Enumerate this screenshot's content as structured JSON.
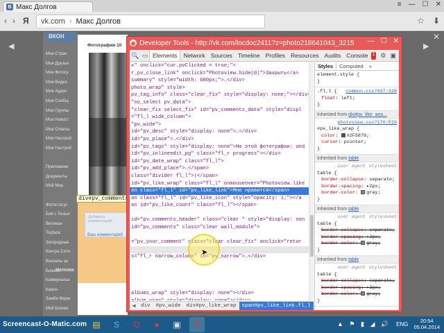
{
  "browser": {
    "tab_title": "Макс Долгов",
    "address_host": "vk.com",
    "address_title": "Макс Долгов",
    "logo": "Я",
    "nav_back": "‹",
    "nav_forward": "›",
    "minimize": "—",
    "maximize": "☐",
    "close": "✕",
    "menu": "≡",
    "download": "⬇",
    "star": "☆"
  },
  "vk_page": {
    "logo": "ВКОН",
    "menu_items": [
      "Мои Стран",
      "Мои Друзья",
      "Мои Фотогр",
      "Мои Видео",
      "Мои Аудио",
      "Мои Сообщ",
      "Мои Группы",
      "Мои Новост",
      "Мои Ответы",
      "Мои Настрой",
      "Мои Настрой",
      "",
      "Приложени",
      "Документы",
      "Мой Мир",
      "",
      "Фотостатус",
      "Бой с Тенью",
      "Вегеман",
      "Topface",
      "Загородные",
      "Контра Сити",
      "Вокзалы за",
      "Бизнес",
      "Коммунальн",
      "Канон",
      "Зомби Ферм",
      "Мой Бизнес"
    ],
    "photo_title": "Фотография 10",
    "comment_placeholder": "Добавить комментарий...",
    "comment_link": "Ваш комментарий",
    "bottom_label": "Напоми",
    "inspect_tooltip": "div#pv_comments_",
    "prev_arrow": "◀",
    "next_arrow": "▶",
    "close_x": "✕"
  },
  "devtools": {
    "title": "Developer Tools - http://vk.com/locdoc2411?z=photo218641043_3215130...",
    "icon_letter": "◉",
    "win_minimize": "—",
    "win_maximize": "☐",
    "win_close": "✕",
    "tool_search": "🔍",
    "tool_device": "▭",
    "tabs": [
      "Elements",
      "Network",
      "Sources",
      "Timeline",
      "Profiles",
      "Resources",
      "Audits",
      "Console"
    ],
    "active_tab": "Elements",
    "error_count": "1",
    "settings_icon": "⚙",
    "dock_icon": "▣",
    "dom_lines": [
      "x\" onclick=\"cur.pvClicked = true;\">",
      "r_pv_close_link\" onclick=\"Photoview.hide(0)\">Закрыть</a>",
      "summary\" style=\"width: 600px;\">…</div>",
      "photo_wrap\" style>",
      "pv_tag_info\" class=\"clear_fix\" style=\"display: none;\"></div>",
      "\"no_select pv_data\">",
      "\"clear_fix select_fix\" id=\"pv_comments_data\" style=\"displ",
      "=\"fl_l wide_column\">",
      "\"pv_wide\">",
      "id=\"pv_desc\" style=\"display: none\">…</div>",
      "id=\"pv_place\">…</div>",
      "id=\"pv_tags\" style=\"display: none\">На этой фотографии: und",
      "id=\"pv_inlineedit_pg\" class=\"fl_r progress\"></div>",
      "id=\"pv_date_wrap\" class=\"fl_l\">",
      "id=\"pv_add_place\">…</span>",
      "class=\"divider fl_l\">|</span>",
      "id=\"pv_like_wrap\" class=\"fl_l\" onmouseover=\"Photoview.like",
      "an class=\"fl_l\" id=\"pv_like_link\">Мне нравится</span>",
      "an class=\"fl_l\" id=\"pv_like_icon\" style=\"opacity: 1;\"></a",
      "an id=\"pv_like_count\" class=\"fl_l\"></span>",
      "",
      "id=\"pv_comments_header\" class=\"clear \" style=\"display: non",
      "id=\"pv_comments\" class=\"clear wall_module\">",
      "",
      "=\"pv_your_comment\" class=\"clear clear_fix\" onclick=\"retur",
      "",
      "s=\"fl_r narrow_column\" id=\"pv_narrow\">…</div>",
      "",
      "",
      "",
      "",
      "albums_wrap\" style=\"display: none\"></div>",
      "album_wrap\" style=\"display: none\"></div>",
      "vtagged_wrap\" style=\"display: none\"></div>",
      "",
      "ap\">…</div>"
    ],
    "selected_line": 17,
    "hover_line": 25,
    "breadcrumbs": [
      "div",
      "#pv_wide",
      "div#pv_like_wrap",
      "span#pv_like_link.fl_l"
    ],
    "breadcrumb_back": "◀",
    "styles_tabs": [
      "Styles",
      "Computed"
    ],
    "styles_more": "»",
    "element_style": "element.style {",
    "rule1": {
      "selector": ".fl_l {",
      "source": "common.css?437:328",
      "prop": "float",
      "value": "left;"
    },
    "inherited1": {
      "label": "Inherited from",
      "link": "div#pv_like_wra..."
    },
    "rule2": {
      "selector": "#pv_like_wrap {",
      "source": "photoview.css?170:519",
      "props": [
        {
          "prop": "color",
          "value": "#2F5879;"
        },
        {
          "prop": "cursor",
          "value": "pointer;"
        }
      ]
    },
    "swatch_color": "#2F5879",
    "inherited_table_label": "Inherited from",
    "inherited_table_link": "table",
    "ua_label": "user agent stylesheet",
    "table_selector": "table {",
    "table_props": [
      {
        "prop": "border-collapse",
        "value": "separate;"
      },
      {
        "prop": "border-spacing",
        "value": "▸2px;"
      },
      {
        "prop": "border-color",
        "value": "gray;"
      }
    ],
    "close_brace": "}"
  },
  "taskbar": {
    "brand": "Screencast-O-Matic.com",
    "language": "ENG",
    "time": "20:54",
    "date": "05.04.2014",
    "tray": "▲ ⚑ ▮ ◢ 🔊"
  }
}
